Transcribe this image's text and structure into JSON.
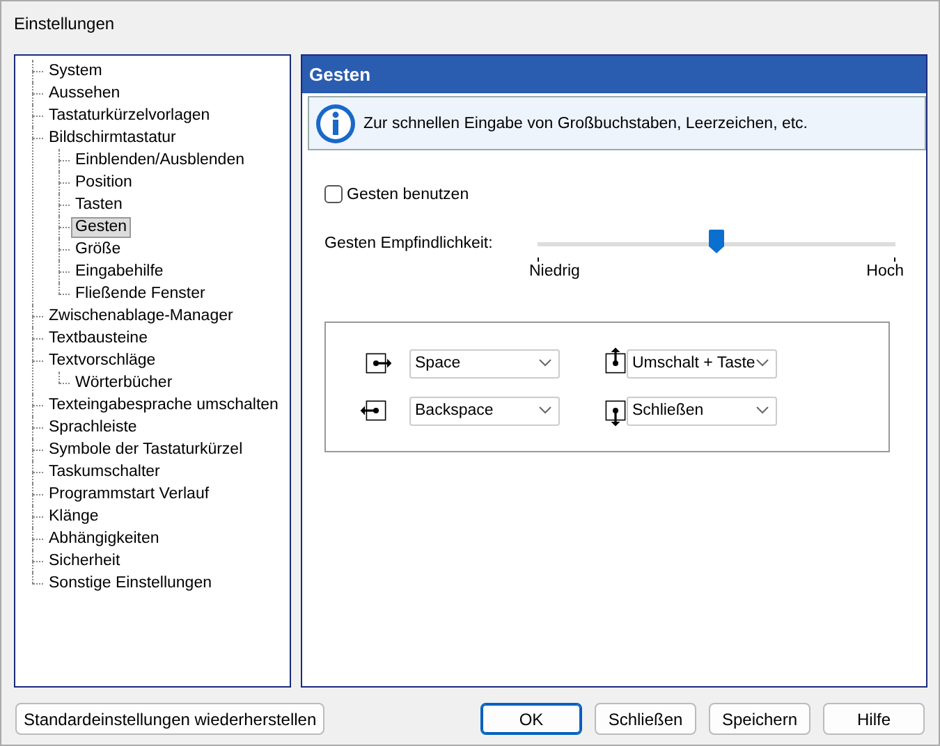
{
  "window": {
    "title": "Einstellungen"
  },
  "sidebar": {
    "items": [
      {
        "label": "System",
        "selected": false
      },
      {
        "label": "Aussehen",
        "selected": false
      },
      {
        "label": "Tastaturkürzelvorlagen",
        "selected": false
      },
      {
        "label": "Bildschirmtastatur",
        "selected": false,
        "children": [
          {
            "label": "Einblenden/Ausblenden",
            "selected": false
          },
          {
            "label": "Position",
            "selected": false
          },
          {
            "label": "Tasten",
            "selected": false
          },
          {
            "label": "Gesten",
            "selected": true
          },
          {
            "label": "Größe",
            "selected": false
          },
          {
            "label": "Eingabehilfe",
            "selected": false
          },
          {
            "label": "Fließende Fenster",
            "selected": false
          }
        ]
      },
      {
        "label": "Zwischenablage-Manager",
        "selected": false
      },
      {
        "label": "Textbausteine",
        "selected": false
      },
      {
        "label": "Textvorschläge",
        "selected": false,
        "children": [
          {
            "label": "Wörterbücher",
            "selected": false
          }
        ]
      },
      {
        "label": "Texteingabesprache umschalten",
        "selected": false
      },
      {
        "label": "Sprachleiste",
        "selected": false
      },
      {
        "label": "Symbole der Tastaturkürzel",
        "selected": false
      },
      {
        "label": "Taskumschalter",
        "selected": false
      },
      {
        "label": "Programmstart Verlauf",
        "selected": false
      },
      {
        "label": "Klänge",
        "selected": false
      },
      {
        "label": "Abhängigkeiten",
        "selected": false
      },
      {
        "label": "Sicherheit",
        "selected": false
      },
      {
        "label": "Sonstige Einstellungen",
        "selected": false
      }
    ]
  },
  "panel": {
    "title": "Gesten",
    "info": "Zur schnellen Eingabe von Großbuchstaben, Leerzeichen, etc.",
    "use_gestures": {
      "label": "Gesten benutzen",
      "checked": false
    },
    "sensitivity": {
      "label": "Gesten Empfindlichkeit:",
      "level": 0.5,
      "min_label": "Niedrig",
      "max_label": "Hoch"
    },
    "gestures": [
      {
        "kind": "right",
        "value": "Space"
      },
      {
        "kind": "up",
        "value": "Umschalt + Taste"
      },
      {
        "kind": "left",
        "value": "Backspace"
      },
      {
        "kind": "down",
        "value": "Schließen"
      }
    ]
  },
  "buttons": {
    "reset": "Standardeinstellungen wiederherstellen",
    "actions": [
      {
        "label": "OK",
        "default": true
      },
      {
        "label": "Schließen",
        "default": false
      },
      {
        "label": "Speichern",
        "default": false
      },
      {
        "label": "Hilfe",
        "default": false
      }
    ]
  }
}
